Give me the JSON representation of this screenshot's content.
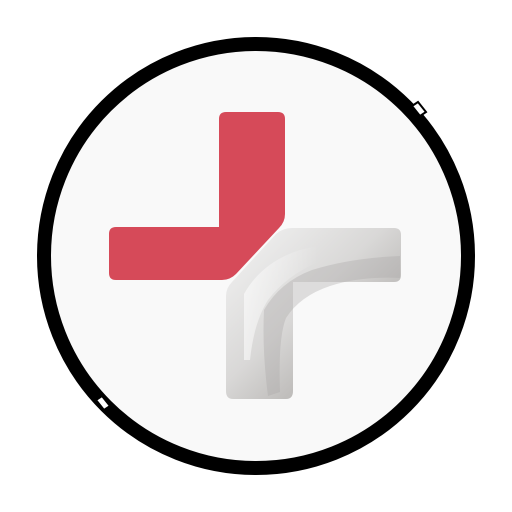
{
  "icon": {
    "name": "medical-cross-app-icon",
    "colors": {
      "background": "#ffffff",
      "disc": "#f9f9f9",
      "ring": "#000000",
      "red_arm": "#d64a59",
      "silver_light": "#f2f2f2",
      "silver_mid": "#d6d5d4",
      "silver_dark": "#b3b1af"
    }
  }
}
